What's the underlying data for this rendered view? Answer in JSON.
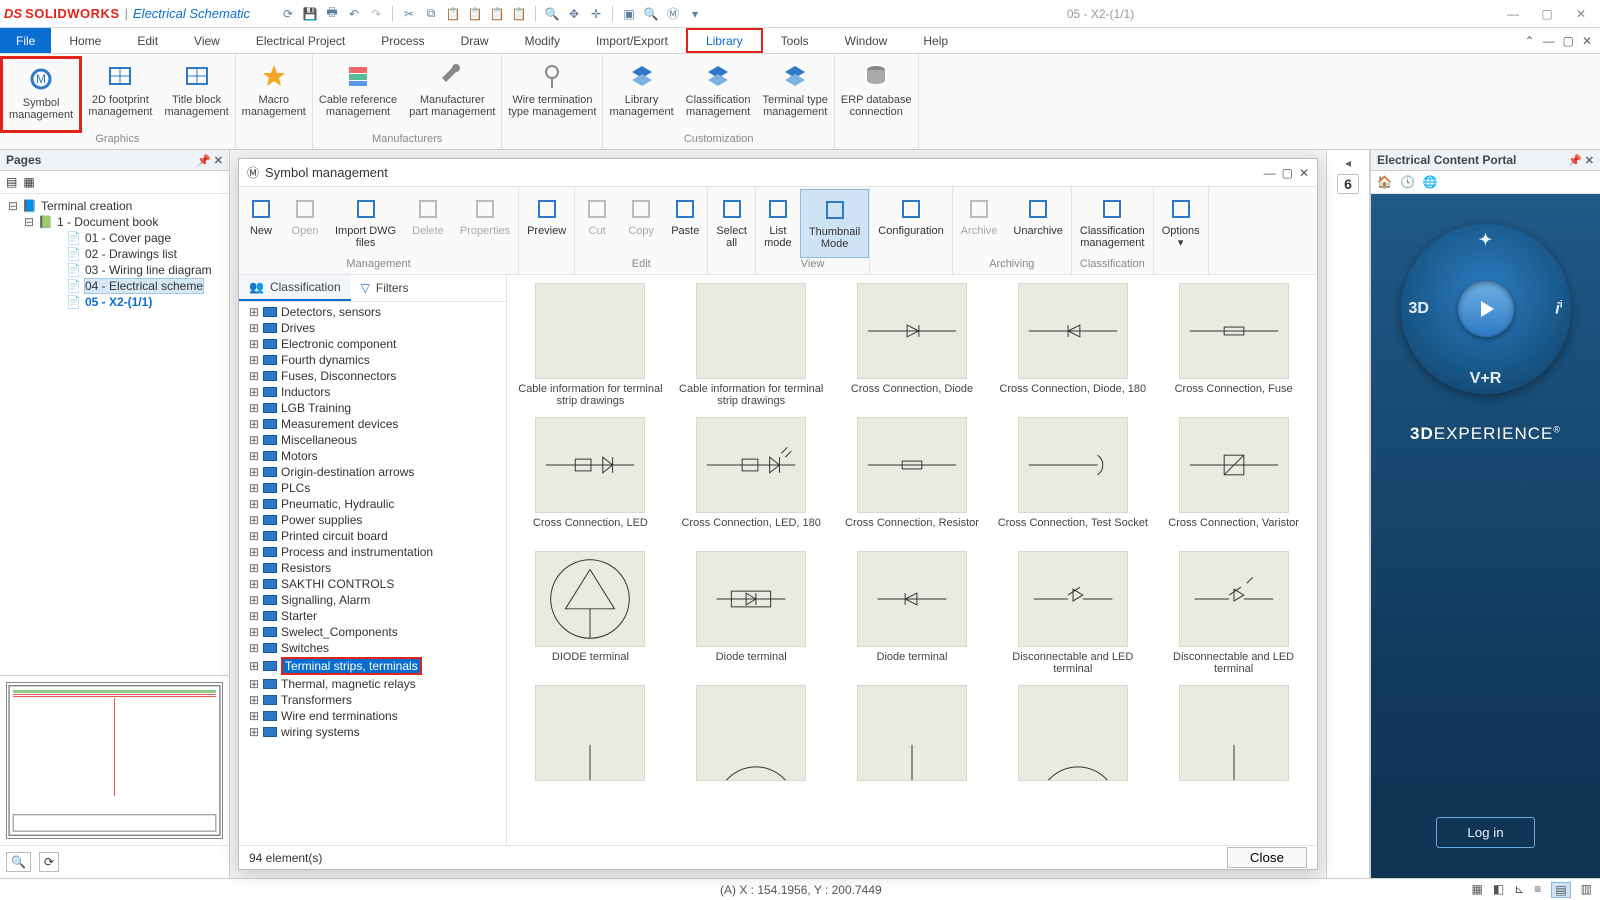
{
  "title": {
    "brand": "SOLIDWORKS",
    "sub": "Electrical Schematic",
    "doc": "05 - X2-(1/1)"
  },
  "menus": {
    "file": "File",
    "items": [
      "Home",
      "Edit",
      "View",
      "Electrical Project",
      "Process",
      "Draw",
      "Modify",
      "Import/Export",
      "Library",
      "Tools",
      "Window",
      "Help"
    ],
    "activeIndex": 8
  },
  "ribbon": {
    "groups": [
      {
        "name": "Graphics",
        "buttons": [
          "Symbol\nmanagement",
          "2D footprint\nmanagement",
          "Title block\nmanagement"
        ]
      },
      {
        "name": "",
        "buttons": [
          "Macro\nmanagement"
        ]
      },
      {
        "name": "Manufacturers",
        "buttons": [
          "Cable reference\nmanagement",
          "Manufacturer\npart management"
        ]
      },
      {
        "name": "",
        "buttons": [
          "Wire termination\ntype management"
        ]
      },
      {
        "name": "Customization",
        "buttons": [
          "Library\nmanagement",
          "Classification\nmanagement",
          "Terminal type\nmanagement"
        ]
      },
      {
        "name": "",
        "buttons": [
          "ERP database\nconnection"
        ]
      }
    ],
    "highlight": "Symbol\nmanagement"
  },
  "pagesPanel": {
    "title": "Pages",
    "root": "Terminal creation",
    "book": "1 - Document book",
    "pages": [
      "01 - Cover page",
      "02 - Drawings list",
      "03 - Wiring line diagram",
      "04 - Electrical scheme",
      "05 - X2-(1/1)"
    ],
    "selectedIndex": 3,
    "activeIndex": 4
  },
  "sm": {
    "title": "Symbol management",
    "toolbar": {
      "groups": [
        {
          "name": "Management",
          "buttons": [
            {
              "l": "New"
            },
            {
              "l": "Open",
              "d": true
            },
            {
              "l": "Import DWG\nfiles"
            },
            {
              "l": "Delete",
              "d": true
            },
            {
              "l": "Properties",
              "d": true
            }
          ]
        },
        {
          "name": "",
          "buttons": [
            {
              "l": "Preview"
            }
          ]
        },
        {
          "name": "Edit",
          "buttons": [
            {
              "l": "Cut",
              "d": true
            },
            {
              "l": "Copy",
              "d": true
            },
            {
              "l": "Paste"
            }
          ]
        },
        {
          "name": "",
          "buttons": [
            {
              "l": "Select\nall"
            }
          ]
        },
        {
          "name": "View",
          "buttons": [
            {
              "l": "List\nmode"
            },
            {
              "l": "Thumbnail\nMode",
              "a": true
            }
          ]
        },
        {
          "name": "",
          "buttons": [
            {
              "l": "Configuration"
            }
          ]
        },
        {
          "name": "Archiving",
          "buttons": [
            {
              "l": "Archive",
              "d": true
            },
            {
              "l": "Unarchive"
            }
          ]
        },
        {
          "name": "Classification",
          "buttons": [
            {
              "l": "Classification\nmanagement"
            }
          ]
        },
        {
          "name": "",
          "buttons": [
            {
              "l": "Options\n▾"
            }
          ]
        }
      ]
    },
    "tabs": {
      "a": "Classification",
      "b": "Filters"
    },
    "tree": [
      "Detectors, sensors",
      "Drives",
      "Electronic component",
      "Fourth dynamics",
      "Fuses, Disconnectors",
      "Inductors",
      "LGB Training",
      "Measurement devices",
      "Miscellaneous",
      "Motors",
      "Origin-destination arrows",
      "PLCs",
      "Pneumatic, Hydraulic",
      "Power supplies",
      "Printed circuit board",
      "Process and instrumentation",
      "Resistors",
      "SAKTHI CONTROLS",
      "Signalling, Alarm",
      "Starter",
      "Swelect_Components",
      "Switches",
      "Terminal strips, terminals",
      "Thermal, magnetic relays",
      "Transformers",
      "Wire end terminations",
      "wiring systems"
    ],
    "treeSelected": 22,
    "items": [
      "Cable information for terminal strip drawings",
      "Cable information for terminal strip drawings",
      "Cross Connection, Diode",
      "Cross Connection, Diode, 180",
      "Cross Connection, Fuse",
      "Cross Connection, LED",
      "Cross Connection, LED, 180",
      "Cross Connection, Resistor",
      "Cross Connection, Test Socket",
      "Cross Connection, Varistor",
      "DIODE terminal",
      "Diode terminal",
      "Diode terminal",
      "Disconnectable and LED terminal",
      "Disconnectable and LED terminal"
    ],
    "status": "94 element(s)",
    "close": "Close"
  },
  "between": {
    "chip": "6"
  },
  "ecp": {
    "title": "Electrical Content Portal",
    "compass": {
      "n": "V+R",
      "s": " ",
      "e": "i",
      "w": "3D"
    },
    "brand": "3DEXPERIENCE",
    "login": "Log in"
  },
  "status": {
    "coords": "(A) X : 154.1956, Y : 200.7449"
  }
}
